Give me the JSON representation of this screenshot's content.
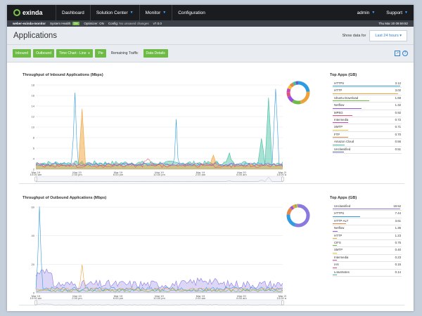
{
  "nav": {
    "logo": "exinda",
    "items": [
      "Dashboard",
      "Solution Center",
      "Monitor",
      "Configuration"
    ],
    "user": "admin",
    "support": "Support"
  },
  "status": {
    "host": "weber-exinda-monitor",
    "health_label": "System Health:",
    "health": "OK",
    "optimizer_label": "Optimizer:",
    "optimizer": "ON",
    "config_label": "Config:",
    "config": "No unsaved changes",
    "version": "v7.0.0",
    "time": "Thu Mar 20 09:59:82"
  },
  "page": {
    "title": "Applications",
    "show_label": "Show data for",
    "range": "Last 24 hours"
  },
  "toolbar": {
    "buttons": [
      "Inbound",
      "Outbound",
      "Time Chart - Line",
      "Pie"
    ],
    "remaining": "Remaining Traffic",
    "data_details": "Data Details",
    "export_icon": "export-icon",
    "help_icon": "help-icon"
  },
  "inbound": {
    "title": "Throughput of Inbound Applications (Mbps)",
    "apps_title": "Top Apps (GB)",
    "apps": [
      {
        "name": "HTTPS",
        "value": "3.12",
        "color": "#2f9be3"
      },
      {
        "name": "HTTP",
        "value": "3.02",
        "color": "#f0a23a"
      },
      {
        "name": "Ubuntu Download",
        "value": "1.69",
        "color": "#6fbb45"
      },
      {
        "name": "Netflow",
        "value": "1.32",
        "color": "#9b51e0"
      },
      {
        "name": "MPEG",
        "value": "0.92",
        "color": "#e0507c"
      },
      {
        "name": "Intermedia",
        "value": "0.72",
        "color": "#c64ab8"
      },
      {
        "name": "SMTP",
        "value": "0.71",
        "color": "#f3c13a"
      },
      {
        "name": "FTP",
        "value": "0.70",
        "color": "#e6874a"
      },
      {
        "name": "Amazon Cloud",
        "value": "0.56",
        "color": "#3fbf9f"
      },
      {
        "name": "Unclassified",
        "value": "0.51",
        "color": "#5a63c8"
      }
    ],
    "yticks": [
      "18",
      "16",
      "14",
      "12",
      "10",
      "8",
      "6",
      "4",
      "2"
    ],
    "xticks": [
      "Mar 19",
      "Mar 19",
      "Mar 19",
      "Mar 19",
      "Mar 19",
      "Mar 20",
      "Mar 20"
    ],
    "navticks": [
      "10:00 am",
      "2:00 pm",
      "6:00 pm",
      "10:00 pm",
      "2:00 am",
      "6:00 am",
      "10:00 am"
    ]
  },
  "outbound": {
    "title": "Throughput of Outbound Applications (Mbps)",
    "apps_title": "Top Apps (GB)",
    "apps": [
      {
        "name": "Unclassified",
        "value": "18.52",
        "color": "#8a7ae0"
      },
      {
        "name": "HTTPS",
        "value": "7.44",
        "color": "#2f9be3"
      },
      {
        "name": "HTTP-ALT",
        "value": "3.61",
        "color": "#e6874a"
      },
      {
        "name": "Netflow",
        "value": "1.36",
        "color": "#9b51e0"
      },
      {
        "name": "HTTP",
        "value": "1.23",
        "color": "#f0a23a"
      },
      {
        "name": "CIFS",
        "value": "0.75",
        "color": "#6fbb45"
      },
      {
        "name": "SMTP",
        "value": "0.40",
        "color": "#f3c13a"
      },
      {
        "name": "Intermedia",
        "value": "0.23",
        "color": "#c64ab8"
      },
      {
        "name": "IAX",
        "value": "0.15",
        "color": "#e0507c"
      },
      {
        "name": "LotusNotes",
        "value": "0.14",
        "color": "#3fbf9f"
      }
    ],
    "yticks": [
      "60",
      "40",
      "20",
      "0"
    ],
    "xticks": [
      "Mar 19",
      "Mar 19",
      "Mar 19",
      "Mar 19",
      "Mar 19",
      "Mar 20",
      "Mar 20"
    ],
    "navticks": [
      "10:00 am",
      "2:00 pm",
      "6:00 pm",
      "10:00 pm",
      "2:00 am",
      "6:00 am",
      "10:00 am"
    ]
  }
}
